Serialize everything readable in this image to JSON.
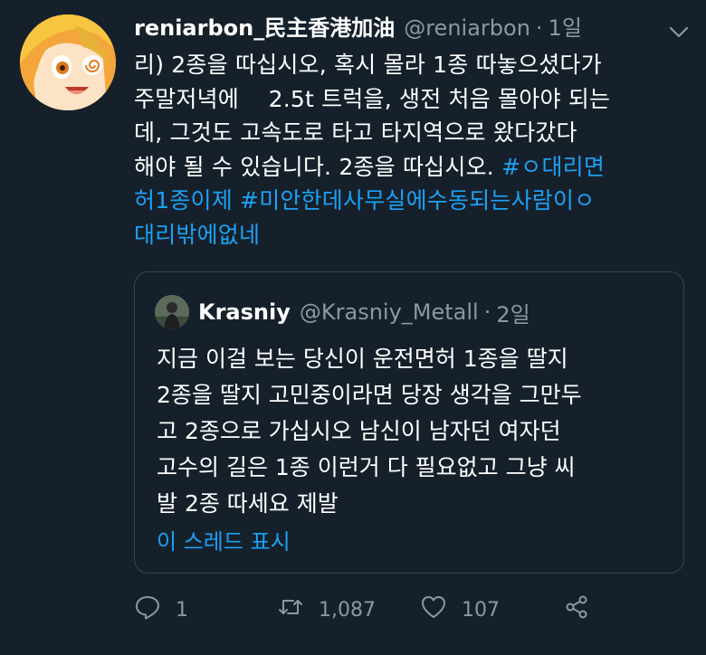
{
  "tweet": {
    "display_name": "reniarbon_民主香港加油",
    "handle": "@reniarbon",
    "separator": "·",
    "time": "1일",
    "body_lines": [
      "리) 2종을 따십시오, 혹시 몰라 1종 따놓으셨다가",
      "주말저녁에    2.5t 트럭을, 생전 처음 몰아야 되는",
      "데, 그것도 고속도로 타고 타지역으로 왔다갔다",
      "해야 될 수 있습니다. 2종을 따십시오. "
    ],
    "hashtag_line4": "#ㅇ대리면",
    "hashtag_line5": "허1종이제 #미안한데사무실에수동되는사람이ㅇ",
    "hashtag_line6": "대리밖에없네"
  },
  "quote": {
    "display_name": "Krasniy",
    "handle": "@Krasniy_Metall",
    "separator": "·",
    "time": "2일",
    "lines": [
      "지금 이걸 보는 당신이 운전면허 1종을 딸지",
      "2종을 딸지 고민중이라면 당장 생각을 그만두",
      "고 2종으로 가십시오 남신이 남자던 여자던",
      "고수의 길은 1종 이런거 다 필요없고 그냥 씨",
      "발 2종 따세요 제발"
    ],
    "show_thread": "이 스레드 표시"
  },
  "actions": {
    "reply_count": "1",
    "retweet_count": "1,087",
    "like_count": "107"
  },
  "colors": {
    "background": "#15202b",
    "accent": "#1da1f2",
    "muted": "#8899a6",
    "border": "#38444d"
  },
  "icons": {
    "avatar": "anime-girl-avatar",
    "quote_avatar": "person-avatar",
    "menu": "chevron-down-icon",
    "reply": "reply-icon",
    "retweet": "retweet-icon",
    "like": "heart-icon",
    "share": "share-icon"
  }
}
